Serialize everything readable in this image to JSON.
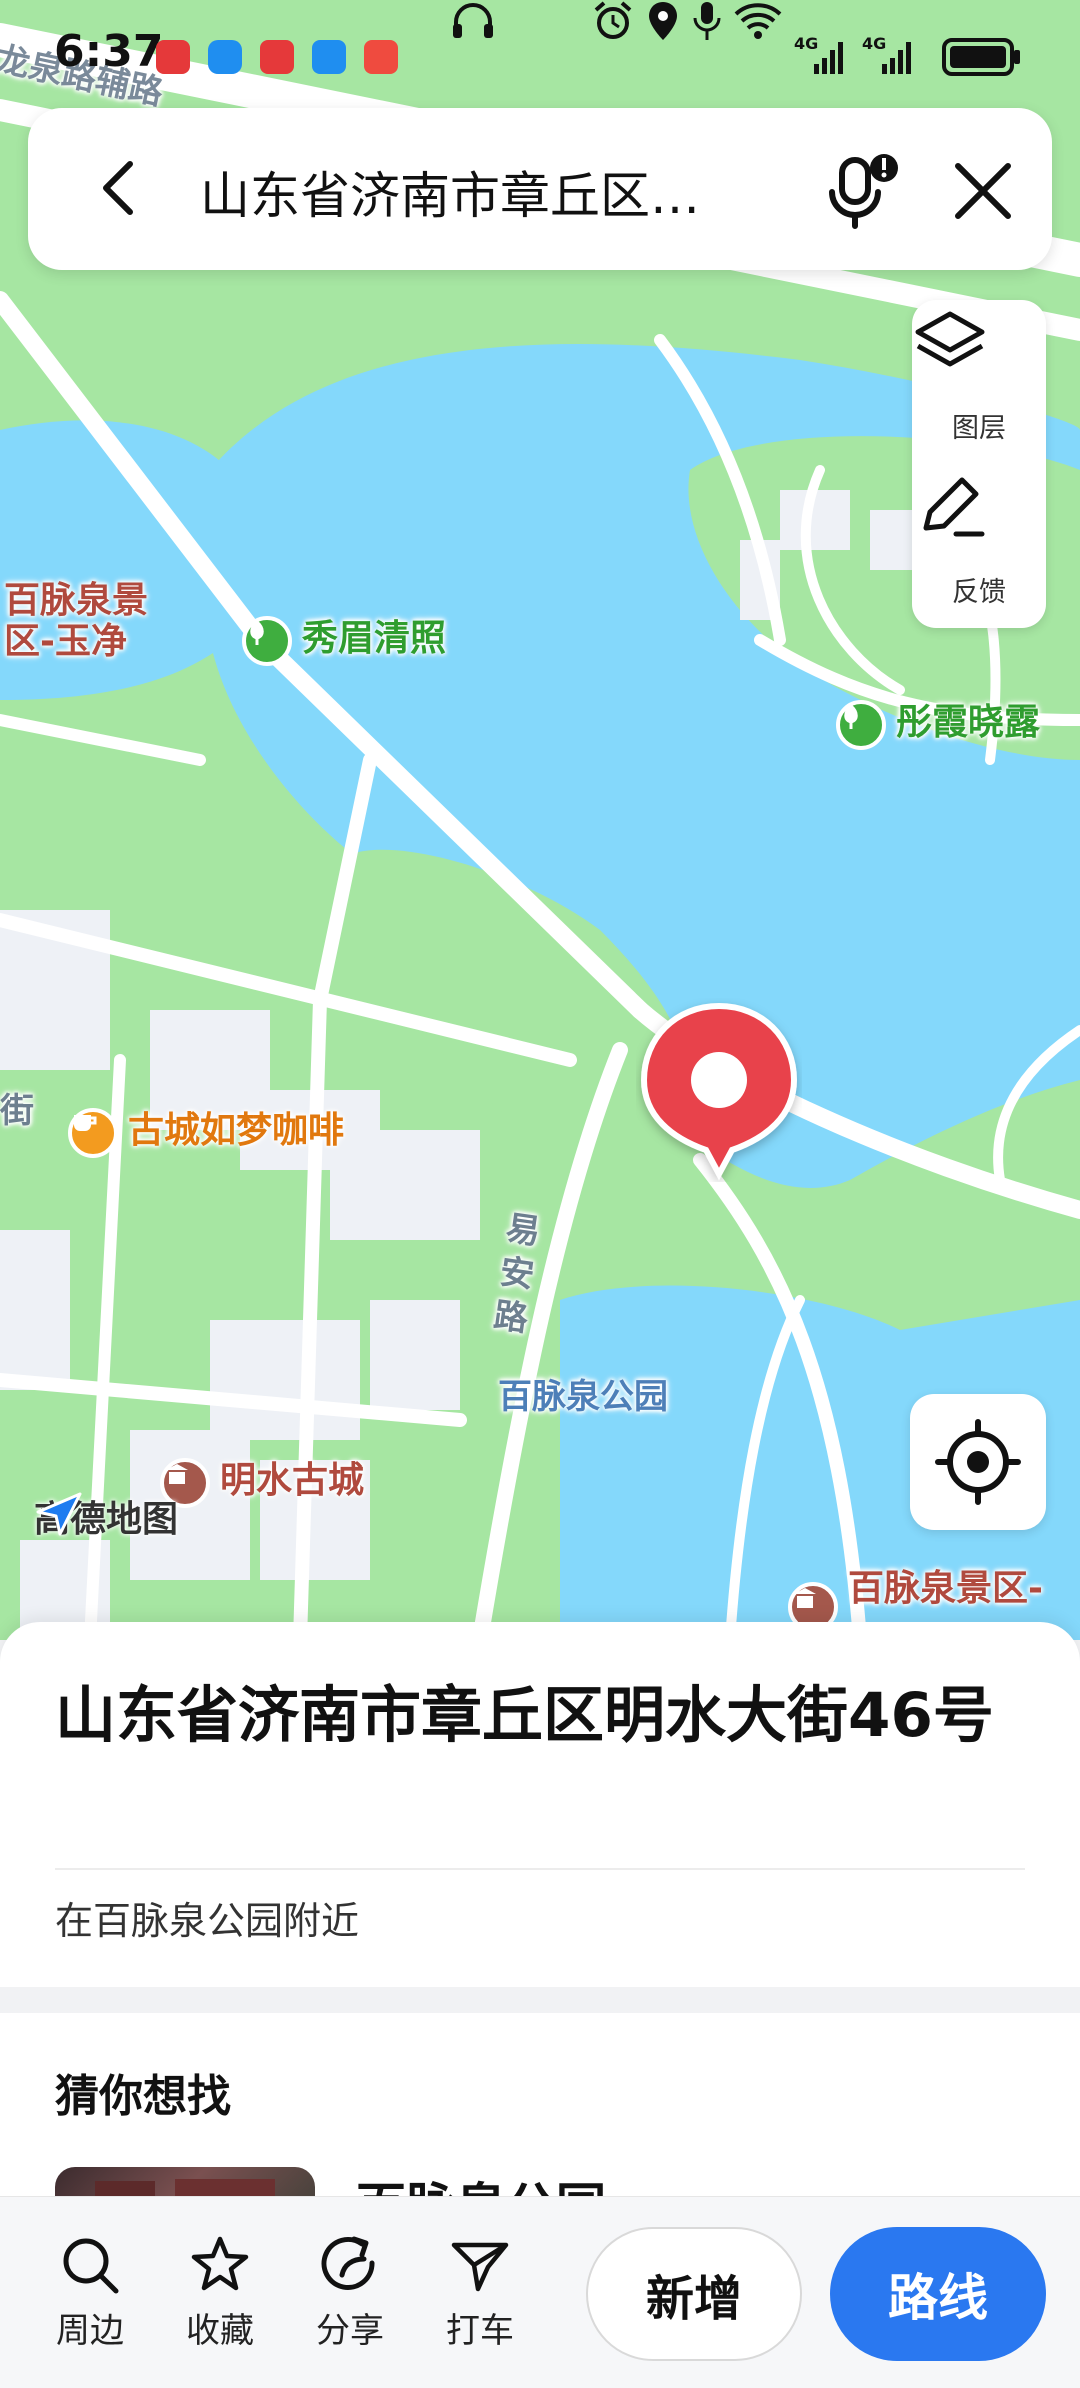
{
  "status_bar": {
    "time": "6:37",
    "network_labels": [
      "4G",
      "4G"
    ]
  },
  "search": {
    "query": "山东省济南市章丘区…",
    "back_icon": "chevron-left-icon",
    "mic_icon": "microphone-icon",
    "close_icon": "close-icon"
  },
  "map_tools": {
    "layers_label": "图层",
    "feedback_label": "反馈"
  },
  "map_labels": {
    "road_top": "龙泉路辅路",
    "baimai_yujing": "百脉泉景\n区-玉净",
    "xiumei": "秀眉清照",
    "tongxia": "彤霞晓露",
    "street_left": "街",
    "cafe": "古城如梦咖啡",
    "yian_road": "易\n安\n路",
    "park": "百脉泉公园",
    "mingshui": "明水古城",
    "baimai_scenic": "百脉泉景区-",
    "logo": "高德地图"
  },
  "sheet": {
    "address": "山东省济南市章丘区明水大街46号",
    "nearby": "在百脉泉公园附近",
    "guess_title": "猜你想找",
    "suggestion_title": "百脉泉公园"
  },
  "bottom_bar": {
    "items": [
      {
        "label": "周边",
        "icon": "search-icon"
      },
      {
        "label": "收藏",
        "icon": "star-icon"
      },
      {
        "label": "分享",
        "icon": "share-icon"
      },
      {
        "label": "打车",
        "icon": "taxi-icon"
      }
    ],
    "new_label": "新增",
    "route_label": "路线"
  },
  "colors": {
    "water": "#84d8fb",
    "park": "#a6e6a2",
    "road": "#ffffff",
    "pin": "#e8434b",
    "primary": "#2a78f0"
  }
}
